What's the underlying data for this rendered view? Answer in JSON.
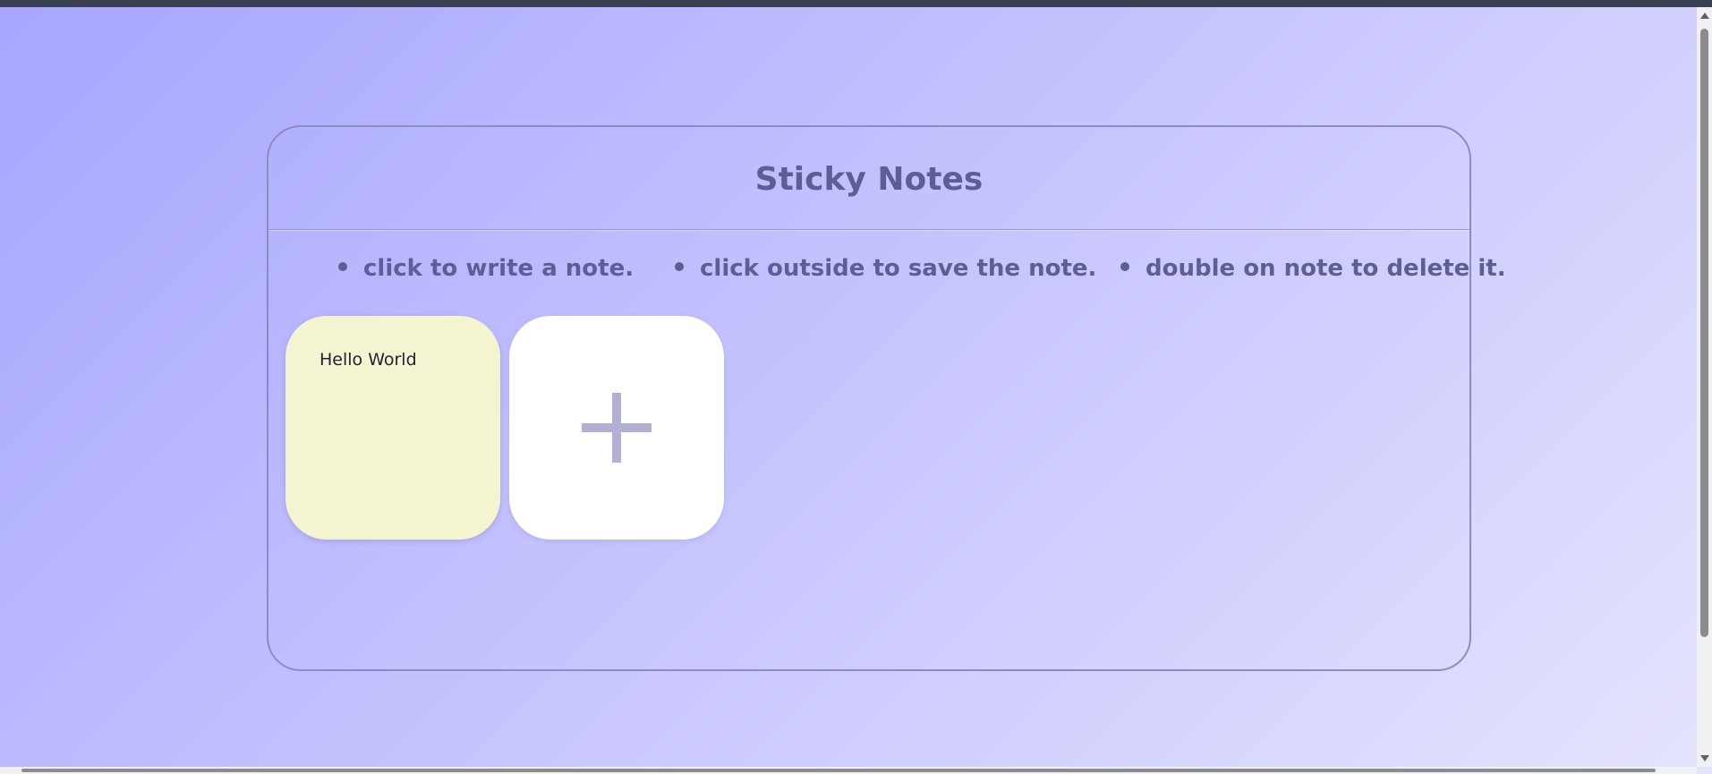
{
  "app": {
    "title": "Sticky Notes"
  },
  "instructions": [
    {
      "text": "click to write a note."
    },
    {
      "text": "click outside to save the note."
    },
    {
      "text": "double on note to delete it."
    }
  ],
  "notes": [
    {
      "text": "Hello World"
    }
  ],
  "add_note": {
    "icon": "plus-icon"
  },
  "colors": {
    "title": "#5e5e96",
    "note_background": "#f4f5d0",
    "add_button_background": "#ffffff",
    "border": "#8d8bc2"
  }
}
